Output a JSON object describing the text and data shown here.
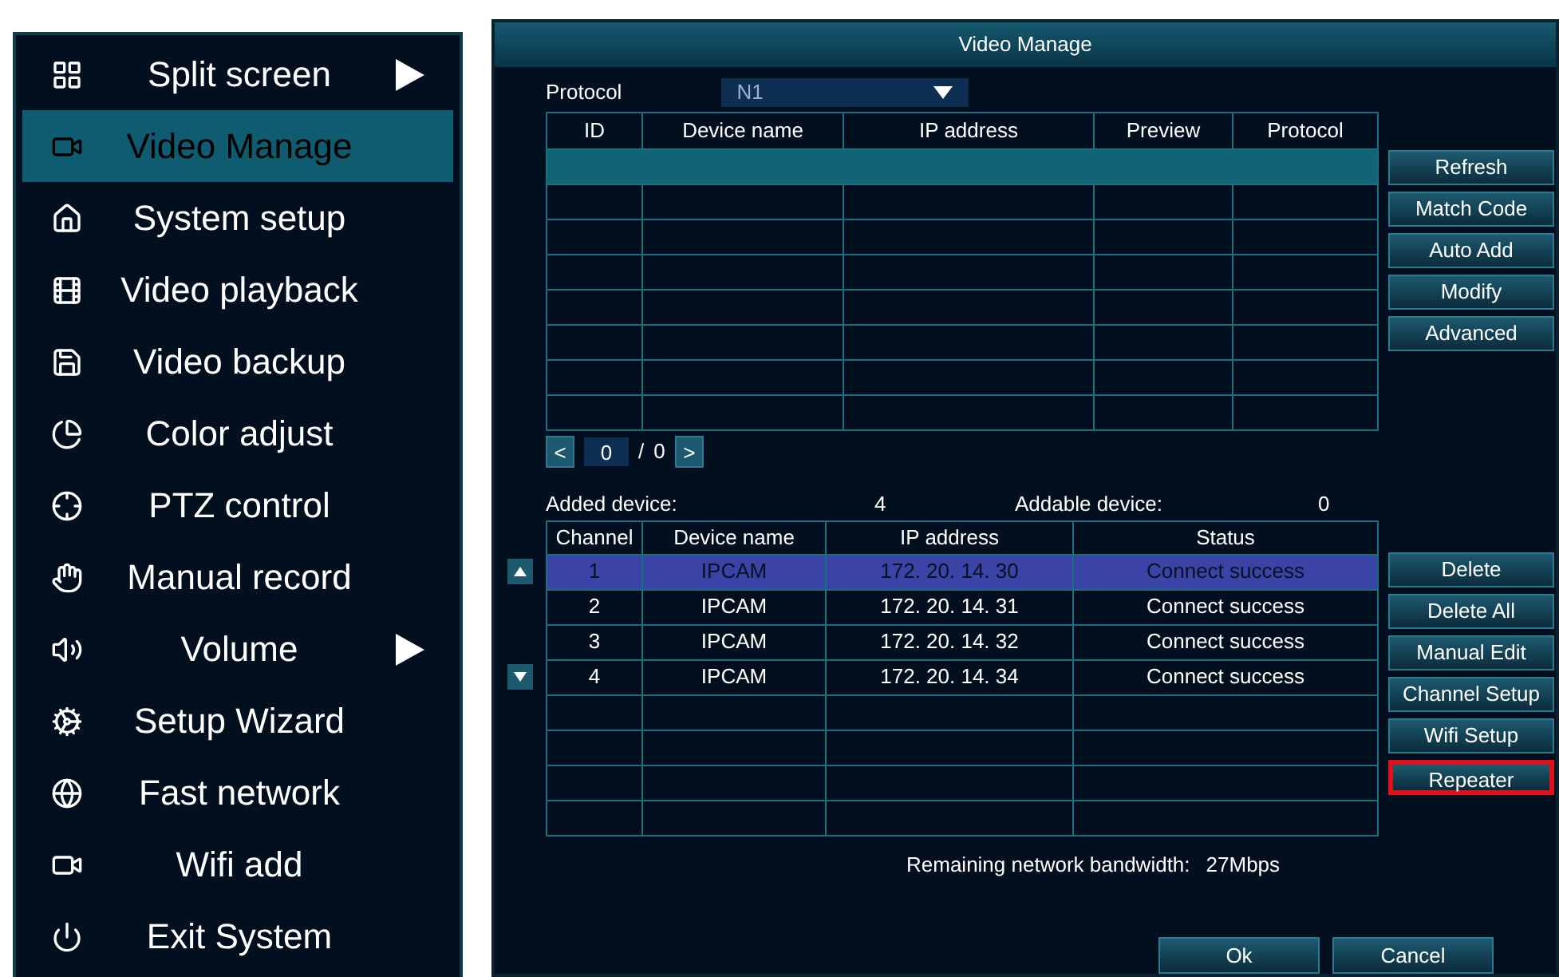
{
  "menu": {
    "items": [
      {
        "label": "Split screen",
        "selected": false,
        "submenu": true
      },
      {
        "label": "Video Manage",
        "selected": true,
        "submenu": false
      },
      {
        "label": "System setup",
        "selected": false,
        "submenu": false
      },
      {
        "label": "Video playback",
        "selected": false,
        "submenu": false
      },
      {
        "label": "Video backup",
        "selected": false,
        "submenu": false
      },
      {
        "label": "Color adjust",
        "selected": false,
        "submenu": false
      },
      {
        "label": "PTZ control",
        "selected": false,
        "submenu": false
      },
      {
        "label": "Manual record",
        "selected": false,
        "submenu": false
      },
      {
        "label": "Volume",
        "selected": false,
        "submenu": true
      },
      {
        "label": "Setup Wizard",
        "selected": false,
        "submenu": false
      },
      {
        "label": "Fast network",
        "selected": false,
        "submenu": false
      },
      {
        "label": "Wifi add",
        "selected": false,
        "submenu": false
      },
      {
        "label": "Exit System",
        "selected": false,
        "submenu": false
      }
    ]
  },
  "dialog": {
    "title": "Video Manage",
    "protocol": {
      "label": "Protocol",
      "value": "N1"
    },
    "search_table": {
      "columns": [
        "ID",
        "Device name",
        "IP address",
        "Preview",
        "Protocol"
      ],
      "rows": [
        {
          "selected": true
        },
        {
          "selected": false
        },
        {
          "selected": false
        },
        {
          "selected": false
        },
        {
          "selected": false
        },
        {
          "selected": false
        },
        {
          "selected": false
        },
        {
          "selected": false
        }
      ]
    },
    "search_buttons": [
      {
        "label": "Refresh",
        "highlighted": false
      },
      {
        "label": "Match Code",
        "highlighted": false
      },
      {
        "label": "Auto Add",
        "highlighted": false
      },
      {
        "label": "Modify",
        "highlighted": false
      },
      {
        "label": "Advanced",
        "highlighted": false
      }
    ],
    "pager": {
      "prev": "<",
      "page": "0",
      "separator": "/",
      "total": "0",
      "next": ">"
    },
    "added_device": {
      "label": "Added device:",
      "value": "4"
    },
    "addable_device": {
      "label": "Addable device:",
      "value": "0"
    },
    "added_table": {
      "columns": [
        "Channel",
        "Device name",
        "IP address",
        "Status"
      ],
      "rows": [
        {
          "selected": true,
          "cells": [
            "1",
            "IPCAM",
            "172. 20. 14. 30",
            "Connect success"
          ]
        },
        {
          "selected": false,
          "cells": [
            "2",
            "IPCAM",
            "172. 20. 14. 31",
            "Connect success"
          ]
        },
        {
          "selected": false,
          "cells": [
            "3",
            "IPCAM",
            "172. 20. 14. 32",
            "Connect success"
          ]
        },
        {
          "selected": false,
          "cells": [
            "4",
            "IPCAM",
            "172. 20. 14. 34",
            "Connect success"
          ]
        },
        {
          "selected": false
        },
        {
          "selected": false
        },
        {
          "selected": false
        },
        {
          "selected": false
        }
      ]
    },
    "added_buttons": [
      {
        "label": "Delete",
        "highlighted": false
      },
      {
        "label": "Delete All",
        "highlighted": false
      },
      {
        "label": "Manual Edit",
        "highlighted": false
      },
      {
        "label": "Channel Setup",
        "highlighted": false
      },
      {
        "label": "Wifi Setup",
        "highlighted": false
      },
      {
        "label": "Repeater",
        "highlighted": true
      }
    ],
    "bandwidth": {
      "label": "Remaining network bandwidth:",
      "value": "27Mbps"
    },
    "footer_buttons": [
      "Ok",
      "Cancel"
    ]
  }
}
